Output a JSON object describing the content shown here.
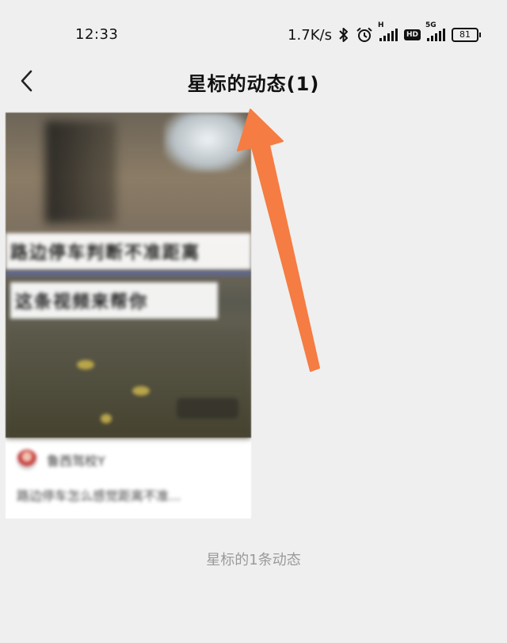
{
  "status_bar": {
    "time": "12:33",
    "net_speed": "1.7K/s",
    "signal1_tag": "H",
    "hd_label": "HD",
    "signal2_tag": "5G",
    "battery_level": "81",
    "icons": [
      "bluetooth-icon",
      "alarm-icon"
    ]
  },
  "header": {
    "title": "星标的动态(1)",
    "back_icon": "chevron-left-icon"
  },
  "card": {
    "caption_line1": "路边停车判断不准距离",
    "caption_line2": "这条视频来帮你",
    "author": "鲁西驾校Y",
    "description": "路边停车怎么感觉距离不准..."
  },
  "footer": {
    "note": "星标的1条动态"
  },
  "colors": {
    "background": "#efefef",
    "arrow": "#f57c42",
    "footer_text": "#9a9a9a"
  }
}
